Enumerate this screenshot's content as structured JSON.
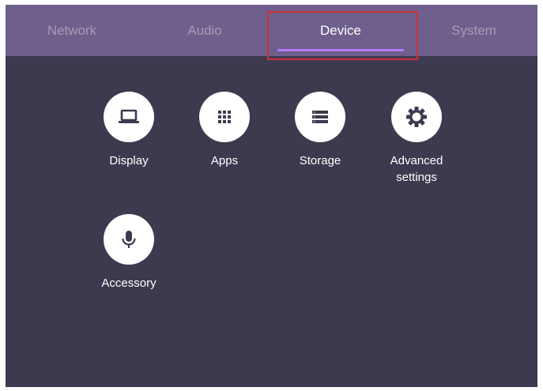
{
  "tabs": [
    {
      "label": "Network",
      "active": false
    },
    {
      "label": "Audio",
      "active": false
    },
    {
      "label": "Device",
      "active": true
    },
    {
      "label": "System",
      "active": false
    }
  ],
  "items": [
    {
      "label": "Display",
      "icon": "laptop-icon"
    },
    {
      "label": "Apps",
      "icon": "apps-grid-icon"
    },
    {
      "label": "Storage",
      "icon": "storage-icon"
    },
    {
      "label": "Advanced\nsettings",
      "icon": "gear-icon"
    },
    {
      "label": "Accessory",
      "icon": "microphone-icon"
    }
  ],
  "colors": {
    "tab_bar": "#6e5f8c",
    "background": "#3d3a4f",
    "active_underline": "#b67cff",
    "highlight_box": "#d0303a",
    "inactive_tab_text": "#a59cb8"
  }
}
